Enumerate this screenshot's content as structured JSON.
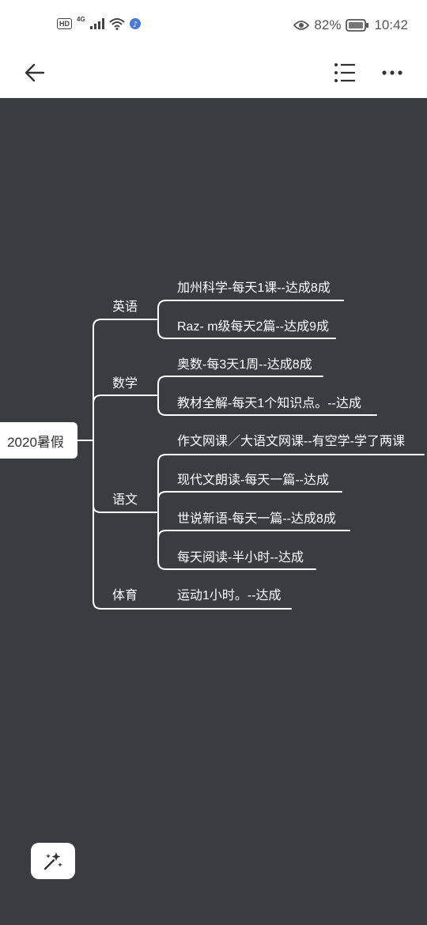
{
  "status_bar": {
    "hd_label": "HD",
    "network_label": "4G",
    "battery_percent": "82%",
    "time": "10:42"
  },
  "mindmap": {
    "root": "2020暑假",
    "branches": [
      {
        "label": "英语",
        "items": [
          "加州科学-每天1课--达成8成",
          "Raz- m级每天2篇--达成9成"
        ]
      },
      {
        "label": "数学",
        "items": [
          "奥数-每3天1周--达成8成",
          "教材全解-每天1个知识点。--达成"
        ]
      },
      {
        "label": "语文",
        "items": [
          "作文网课／大语文网课--有空学-学了两课",
          "现代文朗读-每天一篇--达成",
          "世说新语-每天一篇--达成8成",
          "每天阅读-半小时--达成"
        ]
      },
      {
        "label": "体育",
        "items": [
          "运动1小时。--达成"
        ]
      }
    ]
  },
  "icons": {
    "back": "arrow-left-icon",
    "outline": "list-icon",
    "more": "more-horizontal-icon",
    "magic": "magic-wand-icon"
  }
}
